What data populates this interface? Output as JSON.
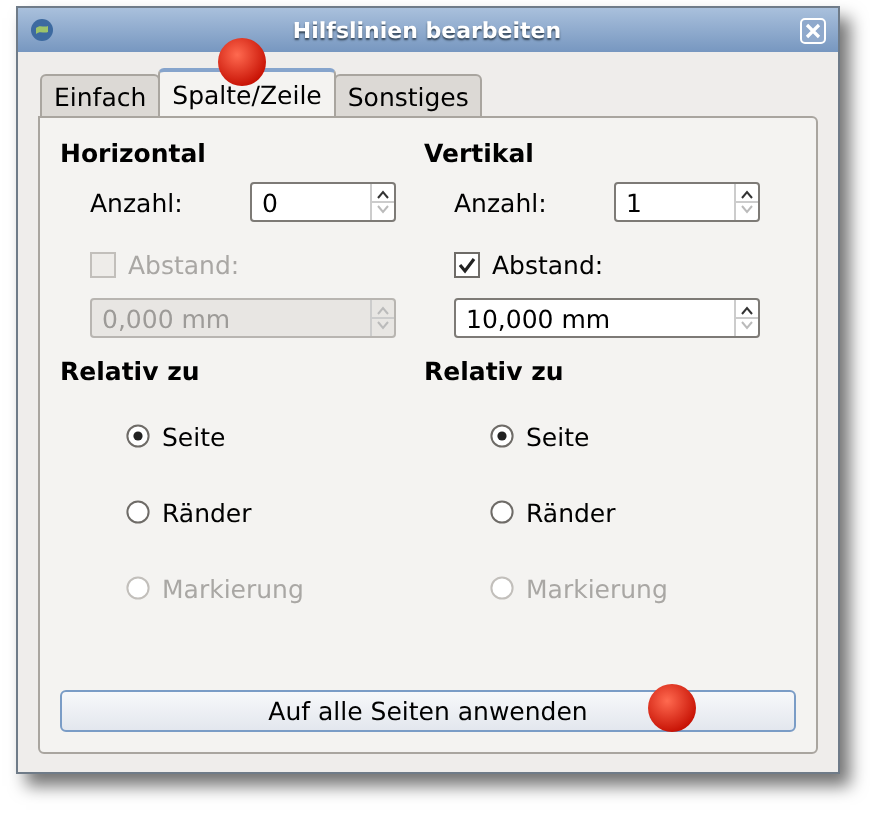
{
  "window": {
    "title": "Hilfslinien bearbeiten"
  },
  "tabs": [
    {
      "label": "Einfach",
      "selected": false
    },
    {
      "label": "Spalte/Zeile",
      "selected": true
    },
    {
      "label": "Sonstiges",
      "selected": false
    }
  ],
  "columns": [
    {
      "heading": "Horizontal",
      "count_label": "Anzahl:",
      "count_value": "0",
      "spacing": {
        "label": "Abstand:",
        "checked": false,
        "disabled": true,
        "value": "0,000 mm"
      },
      "relative_heading": "Relativ zu",
      "options": [
        {
          "label": "Seite",
          "selected": true,
          "disabled": false
        },
        {
          "label": "Ränder",
          "selected": false,
          "disabled": false
        },
        {
          "label": "Markierung",
          "selected": false,
          "disabled": true
        }
      ]
    },
    {
      "heading": "Vertikal",
      "count_label": "Anzahl:",
      "count_value": "1",
      "spacing": {
        "label": "Abstand:",
        "checked": true,
        "disabled": false,
        "value": "10,000 mm"
      },
      "relative_heading": "Relativ zu",
      "options": [
        {
          "label": "Seite",
          "selected": true,
          "disabled": false
        },
        {
          "label": "Ränder",
          "selected": false,
          "disabled": false
        },
        {
          "label": "Markierung",
          "selected": false,
          "disabled": true
        }
      ]
    }
  ],
  "apply_button": "Auf alle Seiten anwenden"
}
